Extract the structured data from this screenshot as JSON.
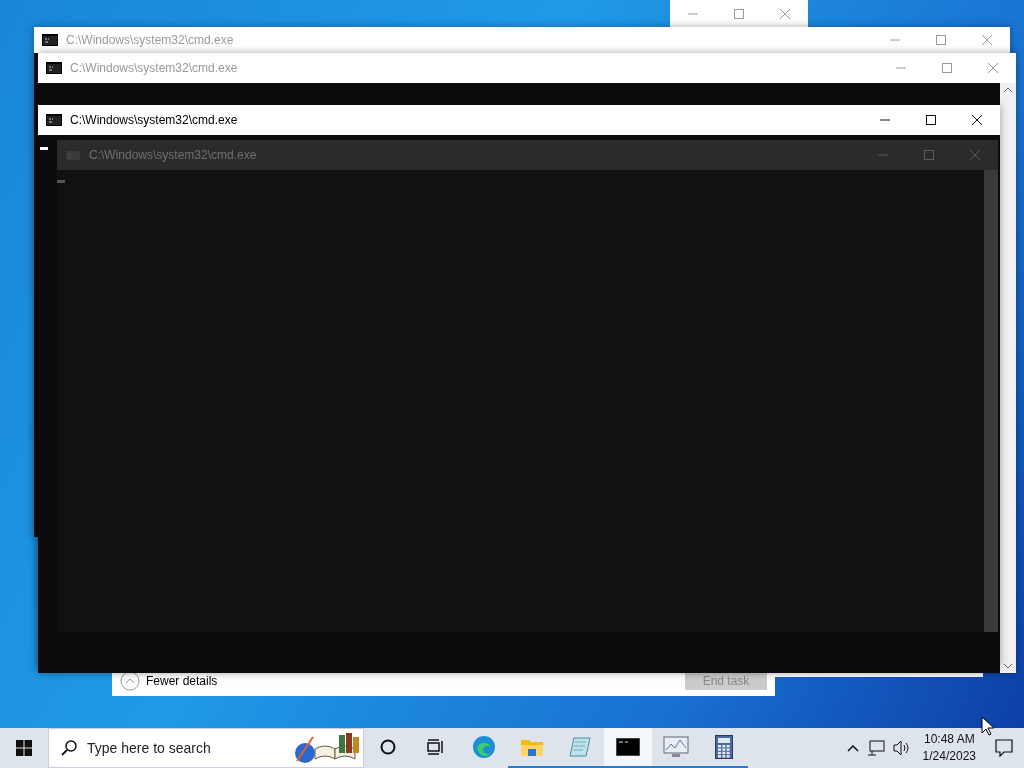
{
  "windows": [
    {
      "title": "C:\\Windows\\system32\\cmd.exe",
      "active": false
    },
    {
      "title": "C:\\Windows\\system32\\cmd.exe",
      "active": false
    },
    {
      "title": "C:\\Windows\\system32\\cmd.exe",
      "active": true
    }
  ],
  "ghost_window": {
    "title": "C:\\Windows\\system32\\cmd.exe"
  },
  "task_manager": {
    "details_toggle": "Fewer details",
    "end_task": {
      "label": "End task",
      "disabled": true
    }
  },
  "taskbar": {
    "search": {
      "placeholder": "Type here to search"
    },
    "apps": [
      {
        "kind": "cortana",
        "running": false,
        "selected": false
      },
      {
        "kind": "taskview",
        "running": false,
        "selected": false
      },
      {
        "kind": "edge",
        "running": false,
        "selected": false
      },
      {
        "kind": "explorer",
        "running": true,
        "selected": false
      },
      {
        "kind": "notepad",
        "running": true,
        "selected": false
      },
      {
        "kind": "console",
        "running": true,
        "selected": true
      },
      {
        "kind": "monitor",
        "running": true,
        "selected": false
      },
      {
        "kind": "calculator",
        "running": true,
        "selected": false
      }
    ],
    "clock": {
      "time": "10:48 AM",
      "date": "1/24/2023"
    }
  }
}
